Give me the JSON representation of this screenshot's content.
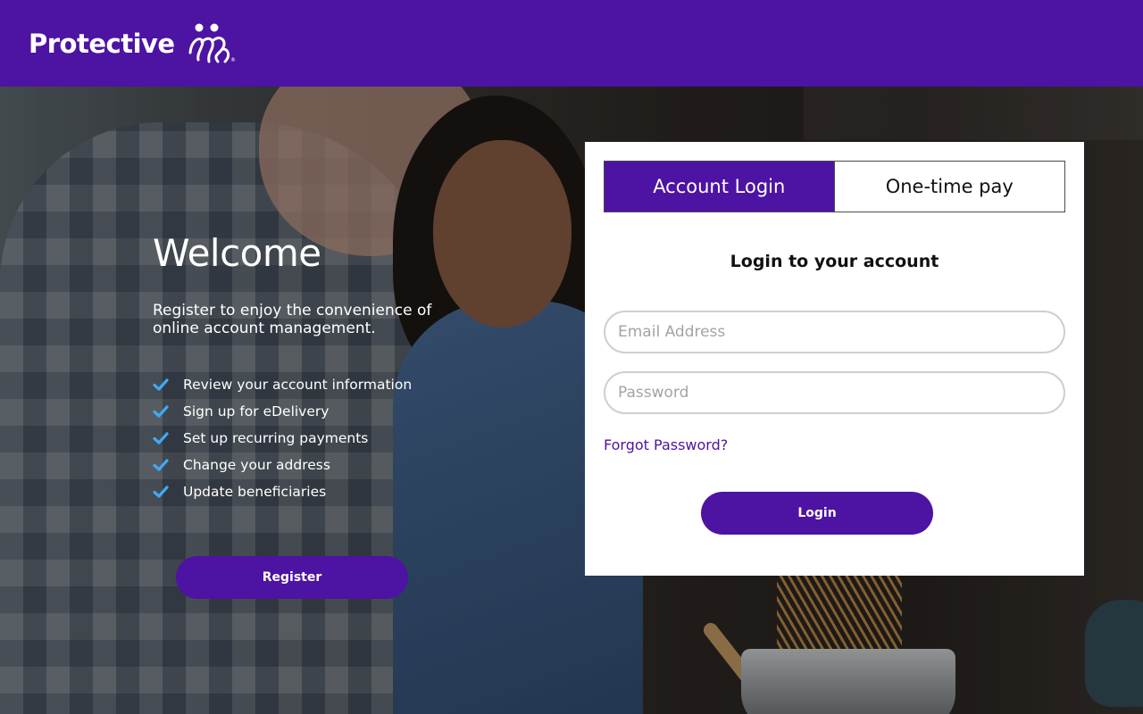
{
  "brand": {
    "name": "Protective",
    "registered_mark": "®",
    "header_color": "#4d13a2"
  },
  "welcome": {
    "title": "Welcome",
    "intro": "Register to enjoy the convenience of online account management.",
    "features": [
      {
        "icon": "check-icon",
        "label": "Review your account information"
      },
      {
        "icon": "check-icon",
        "label": "Sign up for eDelivery"
      },
      {
        "icon": "check-icon",
        "label": "Set up recurring payments"
      },
      {
        "icon": "check-icon",
        "label": "Change your address"
      },
      {
        "icon": "check-icon",
        "label": "Update beneficiaries"
      }
    ],
    "check_color": "#3fa9f5",
    "register_label": "Register"
  },
  "login": {
    "tabs": [
      {
        "label": "Account Login",
        "active": true
      },
      {
        "label": "One-time pay",
        "active": false
      }
    ],
    "title": "Login to your account",
    "email": {
      "value": "",
      "placeholder": "Email Address"
    },
    "password": {
      "value": "",
      "placeholder": "Password"
    },
    "forgot_label": "Forgot Password?",
    "login_label": "Login"
  }
}
